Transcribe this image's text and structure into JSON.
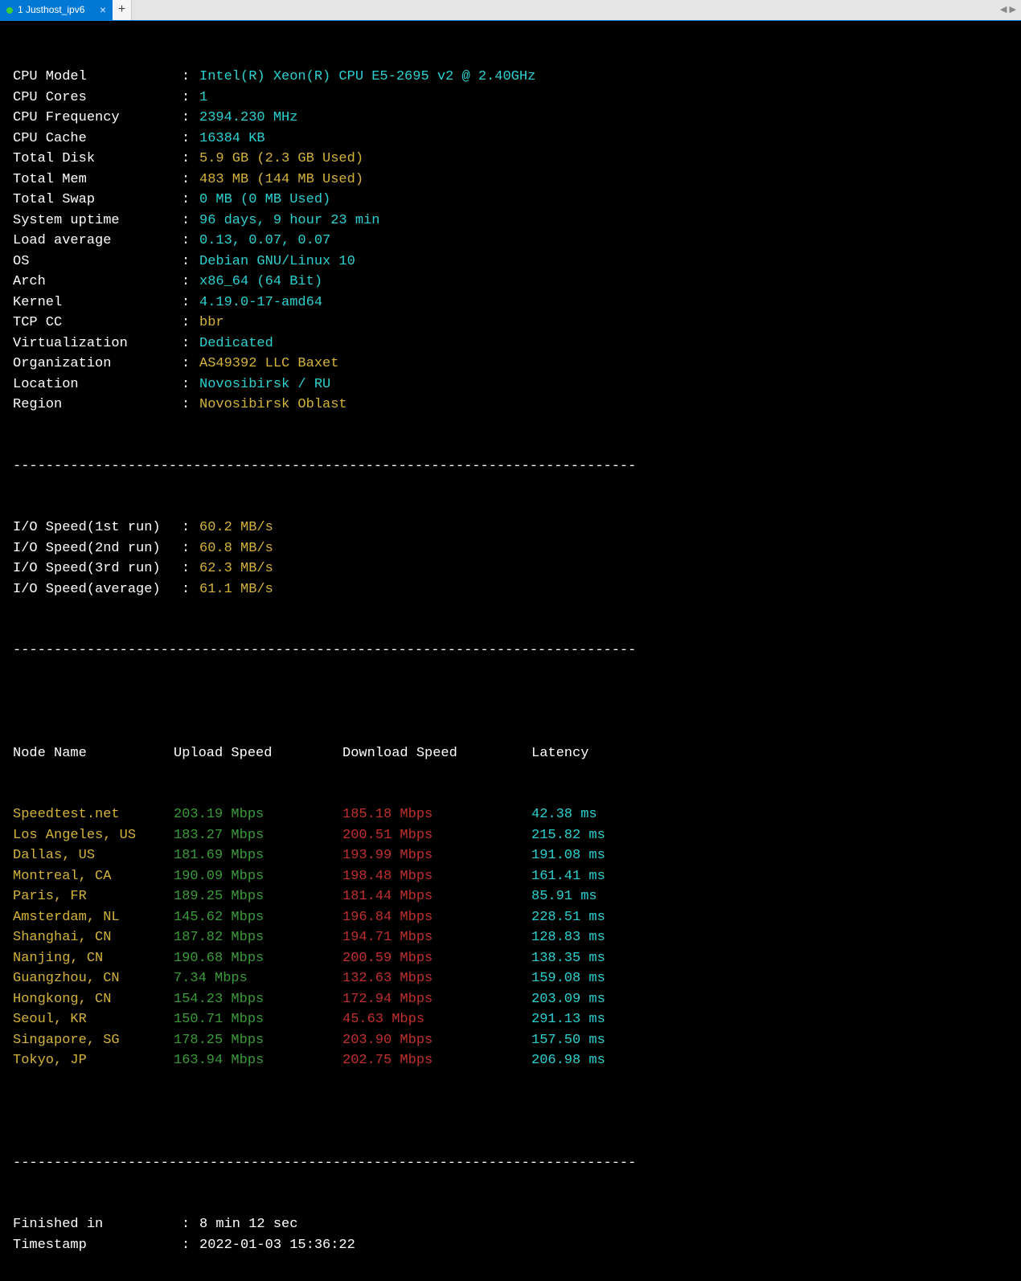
{
  "tab": {
    "title": "1 Justhost_ipv6"
  },
  "dashes": "----------------------------------------------------------------------------",
  "sysinfo": [
    {
      "label": "CPU Model",
      "value": "Intel(R) Xeon(R) CPU E5-2695 v2 @ 2.40GHz",
      "color": "cyan"
    },
    {
      "label": "CPU Cores",
      "value": "1",
      "color": "cyan"
    },
    {
      "label": "CPU Frequency",
      "value": "2394.230 MHz",
      "color": "cyan"
    },
    {
      "label": "CPU Cache",
      "value": "16384 KB",
      "color": "cyan"
    },
    {
      "label": "Total Disk",
      "value": "5.9 GB (2.3 GB Used)",
      "color": "yellow"
    },
    {
      "label": "Total Mem",
      "value": "483 MB (144 MB Used)",
      "color": "yellow"
    },
    {
      "label": "Total Swap",
      "value": "0 MB (0 MB Used)",
      "color": "cyan"
    },
    {
      "label": "System uptime",
      "value": "96 days, 9 hour 23 min",
      "color": "cyan"
    },
    {
      "label": "Load average",
      "value": "0.13, 0.07, 0.07",
      "color": "cyan"
    },
    {
      "label": "OS",
      "value": "Debian GNU/Linux 10",
      "color": "cyan"
    },
    {
      "label": "Arch",
      "value": "x86_64 (64 Bit)",
      "color": "cyan"
    },
    {
      "label": "Kernel",
      "value": "4.19.0-17-amd64",
      "color": "cyan"
    },
    {
      "label": "TCP CC",
      "value": "bbr",
      "color": "yellow"
    },
    {
      "label": "Virtualization",
      "value": "Dedicated",
      "color": "cyan"
    },
    {
      "label": "Organization",
      "value": "AS49392 LLC Baxet",
      "color": "yellow"
    },
    {
      "label": "Location",
      "value": "Novosibirsk / RU",
      "color": "cyan"
    },
    {
      "label": "Region",
      "value": "Novosibirsk Oblast",
      "color": "yellow"
    }
  ],
  "io": [
    {
      "label": "I/O Speed(1st run)",
      "value": "60.2 MB/s"
    },
    {
      "label": "I/O Speed(2nd run)",
      "value": "60.8 MB/s"
    },
    {
      "label": "I/O Speed(3rd run)",
      "value": "62.3 MB/s"
    },
    {
      "label": "I/O Speed(average)",
      "value": "61.1 MB/s"
    }
  ],
  "speedheader": {
    "node": "Node Name",
    "up": "Upload Speed",
    "down": "Download Speed",
    "lat": "Latency"
  },
  "speedtest": [
    {
      "node": "Speedtest.net",
      "up": "203.19 Mbps",
      "down": "185.18 Mbps",
      "lat": "42.38 ms"
    },
    {
      "node": "Los Angeles, US",
      "up": "183.27 Mbps",
      "down": "200.51 Mbps",
      "lat": "215.82 ms"
    },
    {
      "node": "Dallas, US",
      "up": "181.69 Mbps",
      "down": "193.99 Mbps",
      "lat": "191.08 ms"
    },
    {
      "node": "Montreal, CA",
      "up": "190.09 Mbps",
      "down": "198.48 Mbps",
      "lat": "161.41 ms"
    },
    {
      "node": "Paris, FR",
      "up": "189.25 Mbps",
      "down": "181.44 Mbps",
      "lat": "85.91 ms"
    },
    {
      "node": "Amsterdam, NL",
      "up": "145.62 Mbps",
      "down": "196.84 Mbps",
      "lat": "228.51 ms"
    },
    {
      "node": "Shanghai, CN",
      "up": "187.82 Mbps",
      "down": "194.71 Mbps",
      "lat": "128.83 ms"
    },
    {
      "node": "Nanjing, CN",
      "up": "190.68 Mbps",
      "down": "200.59 Mbps",
      "lat": "138.35 ms"
    },
    {
      "node": "Guangzhou, CN",
      "up": "7.34 Mbps",
      "down": "132.63 Mbps",
      "lat": "159.08 ms"
    },
    {
      "node": "Hongkong, CN",
      "up": "154.23 Mbps",
      "down": "172.94 Mbps",
      "lat": "203.09 ms"
    },
    {
      "node": "Seoul, KR",
      "up": "150.71 Mbps",
      "down": "45.63 Mbps",
      "lat": "291.13 ms"
    },
    {
      "node": "Singapore, SG",
      "up": "178.25 Mbps",
      "down": "203.90 Mbps",
      "lat": "157.50 ms"
    },
    {
      "node": "Tokyo, JP",
      "up": "163.94 Mbps",
      "down": "202.75 Mbps",
      "lat": "206.98 ms"
    }
  ],
  "footer": [
    {
      "label": "Finished in",
      "value": "8 min 12 sec"
    },
    {
      "label": "Timestamp",
      "value": "2022-01-03 15:36:22"
    }
  ]
}
